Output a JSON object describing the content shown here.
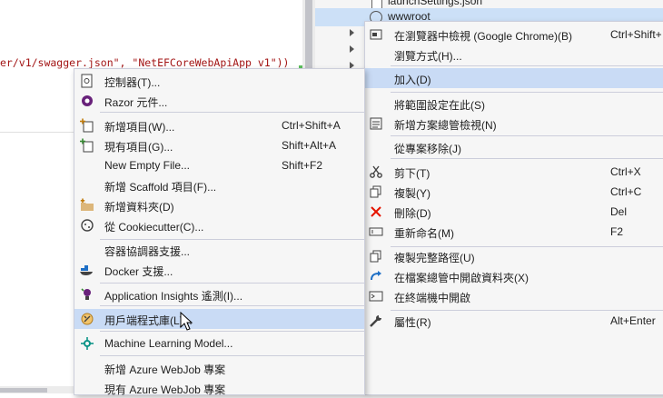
{
  "editor": {
    "code_line": "er/v1/swagger.json\", \"NetEFCoreWebApiApp v1\"))"
  },
  "explorer": {
    "top_item": "launchSettings.json",
    "selected_item": "wwwroot"
  },
  "right_menu": {
    "items": [
      {
        "label": "在瀏覽器中檢視 (Google Chrome)(B)",
        "shortcut": "Ctrl+Shift+",
        "icon": "browser-view-icon"
      },
      {
        "label": "瀏覽方式(H)...",
        "shortcut": "",
        "icon": ""
      },
      {
        "label": "加入(D)",
        "shortcut": "",
        "icon": ""
      },
      {
        "label": "將範圍設定在此(S)",
        "shortcut": "",
        "icon": ""
      },
      {
        "label": "新增方案總管檢視(N)",
        "shortcut": "",
        "icon": "new-solution-view-icon"
      },
      {
        "label": "從專案移除(J)",
        "shortcut": "",
        "icon": ""
      },
      {
        "label": "剪下(T)",
        "shortcut": "Ctrl+X",
        "icon": "scissors-icon"
      },
      {
        "label": "複製(Y)",
        "shortcut": "Ctrl+C",
        "icon": "copy-icon"
      },
      {
        "label": "刪除(D)",
        "shortcut": "Del",
        "icon": "delete-x-icon"
      },
      {
        "label": "重新命名(M)",
        "shortcut": "F2",
        "icon": "rename-icon"
      },
      {
        "label": "複製完整路徑(U)",
        "shortcut": "",
        "icon": "copy-path-icon"
      },
      {
        "label": "在檔案總管中開啟資料夾(X)",
        "shortcut": "",
        "icon": "open-folder-arrow-icon"
      },
      {
        "label": "在終端機中開啟",
        "shortcut": "",
        "icon": "terminal-icon"
      },
      {
        "label": "屬性(R)",
        "shortcut": "Alt+Enter",
        "icon": "wrench-icon"
      }
    ]
  },
  "left_menu": {
    "items": [
      {
        "label": "控制器(T)...",
        "shortcut": "",
        "icon": "controller-icon"
      },
      {
        "label": "Razor 元件...",
        "shortcut": "",
        "icon": "razor-icon"
      },
      {
        "label": "新增項目(W)...",
        "shortcut": "Ctrl+Shift+A",
        "icon": "new-item-icon"
      },
      {
        "label": "現有項目(G)...",
        "shortcut": "Shift+Alt+A",
        "icon": "existing-item-icon"
      },
      {
        "label": "New Empty File...",
        "shortcut": "Shift+F2",
        "icon": ""
      },
      {
        "label": "新增 Scaffold 項目(F)...",
        "shortcut": "",
        "icon": ""
      },
      {
        "label": "新增資料夾(D)",
        "shortcut": "",
        "icon": "new-folder-icon"
      },
      {
        "label": "從 Cookiecutter(C)...",
        "shortcut": "",
        "icon": "cookiecutter-icon"
      },
      {
        "label": "容器協調器支援...",
        "shortcut": "",
        "icon": ""
      },
      {
        "label": "Docker 支援...",
        "shortcut": "",
        "icon": "docker-icon"
      },
      {
        "label": "Application Insights 遙測(I)...",
        "shortcut": "",
        "icon": "app-insights-icon"
      },
      {
        "label": "用戶端程式庫(L)...",
        "shortcut": "",
        "icon": "client-library-icon"
      },
      {
        "label": "Machine Learning Model...",
        "shortcut": "",
        "icon": "ml-model-icon"
      },
      {
        "label": "新增 Azure WebJob 專案",
        "shortcut": "",
        "icon": ""
      },
      {
        "label": "現有 Azure WebJob 專案",
        "shortcut": "",
        "icon": ""
      }
    ]
  },
  "colors": {
    "menu_bg": "#f6f6f6",
    "highlight": "#c9dbf5",
    "selection": "#cce0f7",
    "delete_red": "#e51400",
    "vs_purple": "#68217a"
  }
}
